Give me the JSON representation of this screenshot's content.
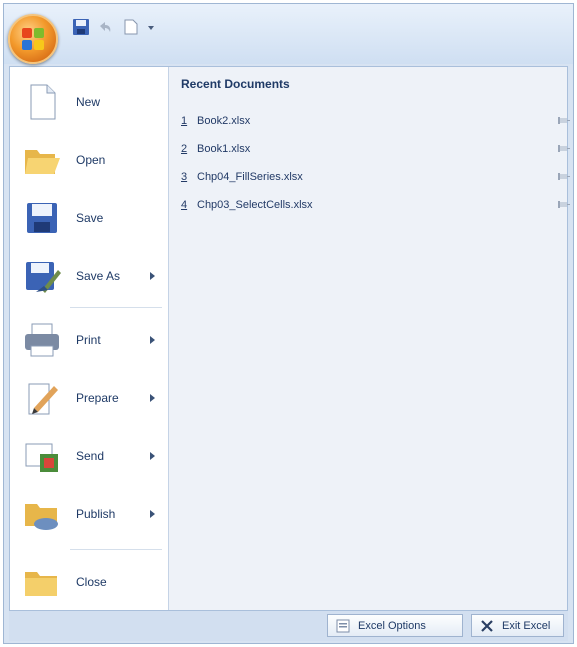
{
  "quick_access": {
    "icons": [
      "save-icon",
      "undo-icon",
      "redo-icon",
      "customize-dropdown-icon"
    ]
  },
  "menu": {
    "items": [
      {
        "label": "New",
        "icon": "new-document-icon",
        "has_submenu": false
      },
      {
        "label": "Open",
        "icon": "open-folder-icon",
        "has_submenu": false
      },
      {
        "label": "Save",
        "icon": "save-icon",
        "has_submenu": false
      },
      {
        "label": "Save As",
        "icon": "save-as-icon",
        "has_submenu": true
      },
      {
        "label": "Print",
        "icon": "printer-icon",
        "has_submenu": true
      },
      {
        "label": "Prepare",
        "icon": "prepare-icon",
        "has_submenu": true
      },
      {
        "label": "Send",
        "icon": "send-icon",
        "has_submenu": true
      },
      {
        "label": "Publish",
        "icon": "publish-icon",
        "has_submenu": true
      },
      {
        "label": "Close",
        "icon": "close-folder-icon",
        "has_submenu": false
      }
    ]
  },
  "recent": {
    "title": "Recent Documents",
    "items": [
      {
        "num": "1",
        "name": "Book2.xlsx"
      },
      {
        "num": "2",
        "name": "Book1.xlsx"
      },
      {
        "num": "3",
        "name": "Chp04_FillSeries.xlsx"
      },
      {
        "num": "4",
        "name": "Chp03_SelectCells.xlsx"
      }
    ]
  },
  "footer": {
    "options_label": "Excel Options",
    "exit_label": "Exit Excel"
  },
  "colors": {
    "accent": "#1f3a66",
    "office_orange": "#f39a2c"
  }
}
